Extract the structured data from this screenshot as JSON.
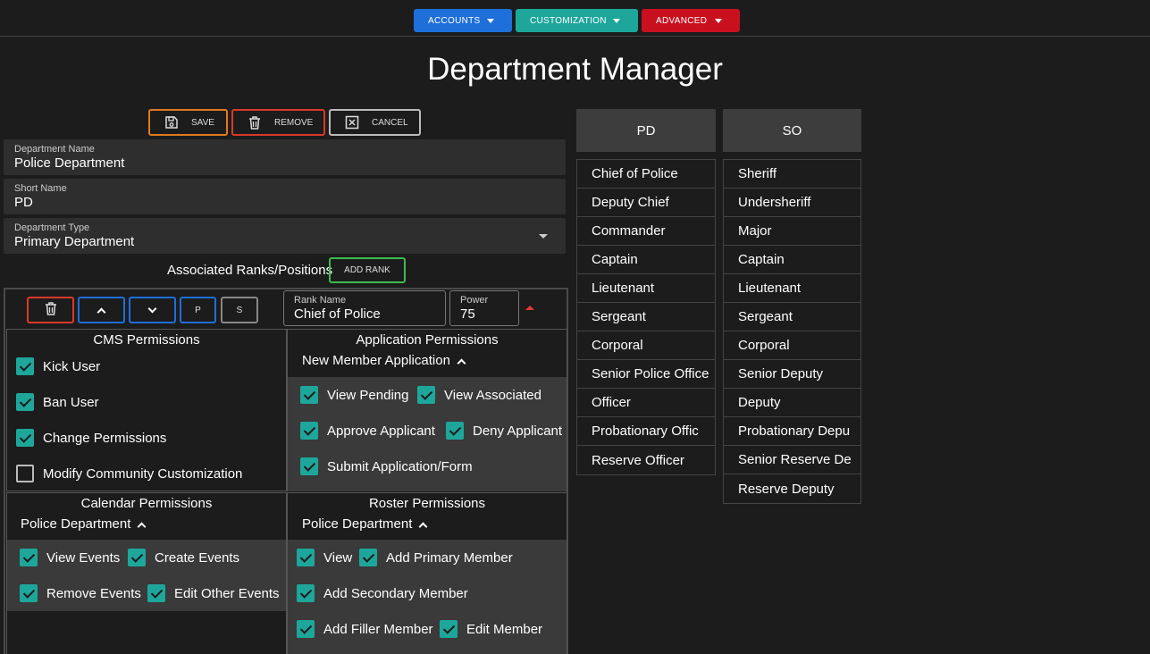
{
  "nav": {
    "accounts": "ACCOUNTS",
    "customization": "CUSTOMIZATION",
    "advanced": "ADVANCED"
  },
  "page_title": "Department Manager",
  "actions": {
    "save": "SAVE",
    "remove": "REMOVE",
    "cancel": "CANCEL"
  },
  "fields": {
    "dept_name": {
      "label": "Department Name",
      "value": "Police Department"
    },
    "short_name": {
      "label": "Short Name",
      "value": "PD"
    },
    "dept_type": {
      "label": "Department Type",
      "value": "Primary Department"
    }
  },
  "ranks": {
    "label": "Associated Ranks/Positions",
    "add_button": "ADD RANK",
    "p_button": "P",
    "s_button": "S",
    "rank_name": {
      "label": "Rank Name",
      "value": "Chief of Police"
    },
    "power": {
      "label": "Power",
      "value": "75"
    }
  },
  "cms": {
    "title": "CMS Permissions",
    "items": [
      {
        "label": "Kick User",
        "checked": true
      },
      {
        "label": "Ban User",
        "checked": true
      },
      {
        "label": "Change Permissions",
        "checked": true
      },
      {
        "label": "Modify Community Customization",
        "checked": false
      }
    ]
  },
  "application": {
    "title": "Application Permissions",
    "subtitle": "New Member Application",
    "items": [
      {
        "label": "View Pending",
        "checked": true
      },
      {
        "label": "View Associated",
        "checked": true
      },
      {
        "label": "Approve Applicant",
        "checked": true
      },
      {
        "label": "Deny Applicant",
        "checked": true
      },
      {
        "label": "Submit Application/Form",
        "checked": true
      }
    ]
  },
  "calendar": {
    "title": "Calendar Permissions",
    "subtitle": "Police Department",
    "items": [
      {
        "label": "View Events",
        "checked": true
      },
      {
        "label": "Create Events",
        "checked": true
      },
      {
        "label": "Remove Events",
        "checked": true
      },
      {
        "label": "Edit Other Events",
        "checked": true
      }
    ]
  },
  "roster": {
    "title": "Roster Permissions",
    "subtitle": "Police Department",
    "items": [
      {
        "label": "View",
        "checked": true
      },
      {
        "label": "Add Primary Member",
        "checked": true
      },
      {
        "label": "Add Secondary Member",
        "checked": true
      },
      {
        "label": "Add Filler Member",
        "checked": true
      },
      {
        "label": "Edit Member",
        "checked": true
      }
    ]
  },
  "columns": {
    "pd": {
      "header": "PD",
      "items": [
        "Chief of Police",
        "Deputy Chief",
        "Commander",
        "Captain",
        "Lieutenant",
        "Sergeant",
        "Corporal",
        "Senior Police Office",
        "Officer",
        "Probationary Offic",
        "Reserve Officer"
      ]
    },
    "so": {
      "header": "SO",
      "items": [
        "Sheriff",
        "Undersheriff",
        "Major",
        "Captain",
        "Lieutenant",
        "Sergeant",
        "Corporal",
        "Senior Deputy",
        "Deputy",
        "Probationary Depu",
        "Senior Reserve De",
        "Reserve Deputy"
      ]
    }
  },
  "colors": {
    "accounts": "#1e6fd9",
    "customization": "#1ea69b",
    "advanced": "#c8101f",
    "checkbox": "#1ea69b"
  }
}
